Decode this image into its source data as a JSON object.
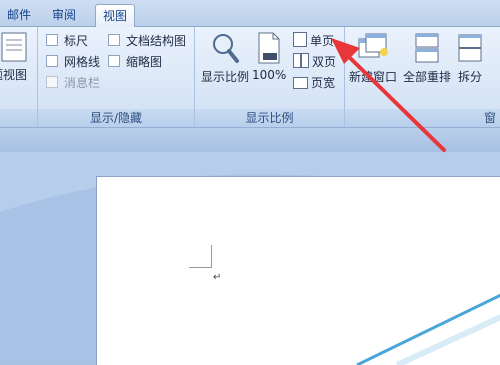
{
  "tabs": [
    {
      "label": "邮件"
    },
    {
      "label": "审阅"
    },
    {
      "label": "视图"
    }
  ],
  "ribbon": {
    "left_partial_label": "题视图",
    "show_hide": {
      "items": [
        {
          "label": "标尺",
          "checked": false,
          "disabled": false
        },
        {
          "label": "网格线",
          "checked": false,
          "disabled": false
        },
        {
          "label": "消息栏",
          "checked": false,
          "disabled": true
        },
        {
          "label": "文档结构图",
          "checked": false,
          "disabled": false
        },
        {
          "label": "缩略图",
          "checked": false,
          "disabled": false
        }
      ],
      "group_label": "显示/隐藏"
    },
    "zoom": {
      "zoom_label": "显示比例",
      "percent_label": "100%",
      "one_page": "单页",
      "two_pages": "双页",
      "page_width": "页宽",
      "group_label": "显示比例"
    },
    "window": {
      "new_window": "新建窗口",
      "arrange_all": "全部重排",
      "split": "拆分",
      "group_label_partial": "窗"
    }
  },
  "document": {
    "paragraph_mark": "↵"
  },
  "colors": {
    "arrow": "#e8363a",
    "tab_text": "#15428b",
    "page_diagonal": "#4aa6d8"
  }
}
